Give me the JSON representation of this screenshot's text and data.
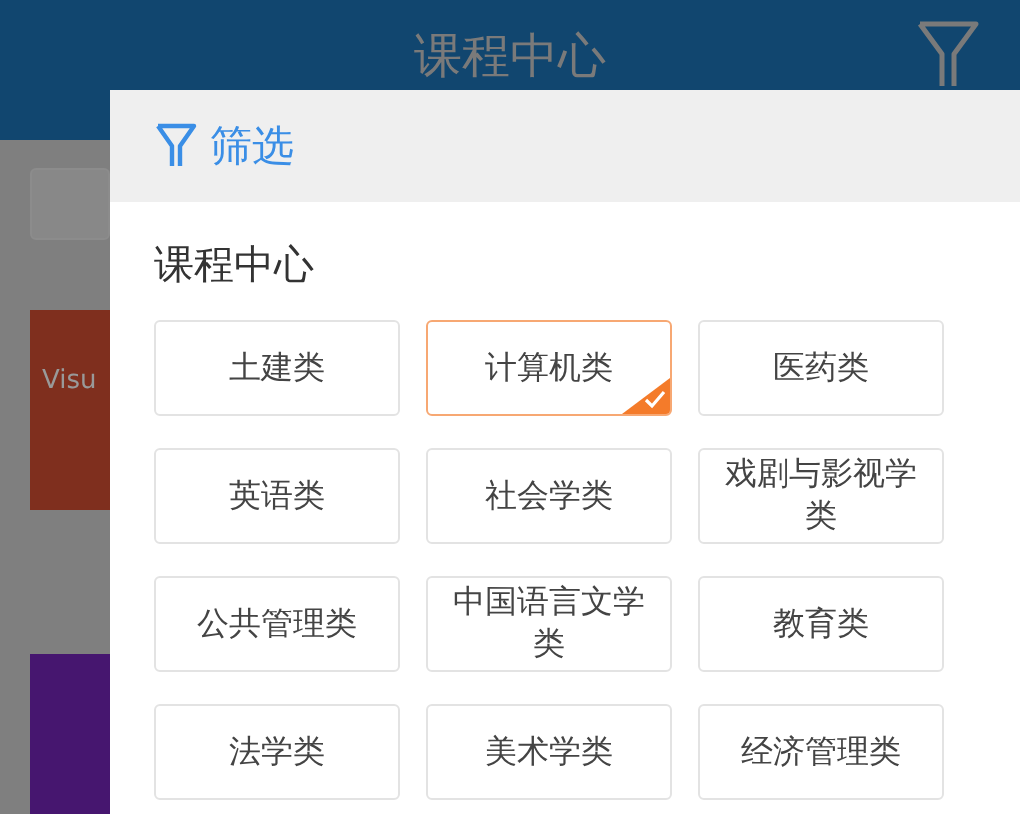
{
  "app_bar": {
    "title": "课程中心"
  },
  "background_cards": [
    {
      "label": "Visu",
      "color": "#7f2f1e"
    },
    {
      "color": "#46166f"
    }
  ],
  "filter_panel": {
    "header": "筛选",
    "section_title": "课程中心",
    "options": [
      {
        "label": "土建类",
        "selected": false
      },
      {
        "label": "计算机类",
        "selected": true
      },
      {
        "label": "医药类",
        "selected": false
      },
      {
        "label": "英语类",
        "selected": false
      },
      {
        "label": "社会学类",
        "selected": false
      },
      {
        "label": "戏剧与影视学类",
        "selected": false
      },
      {
        "label": "公共管理类",
        "selected": false
      },
      {
        "label": "中国语言文学类",
        "selected": false
      },
      {
        "label": "教育类",
        "selected": false
      },
      {
        "label": "法学类",
        "selected": false
      },
      {
        "label": "美术学类",
        "selected": false
      },
      {
        "label": "经济管理类",
        "selected": false
      }
    ]
  }
}
